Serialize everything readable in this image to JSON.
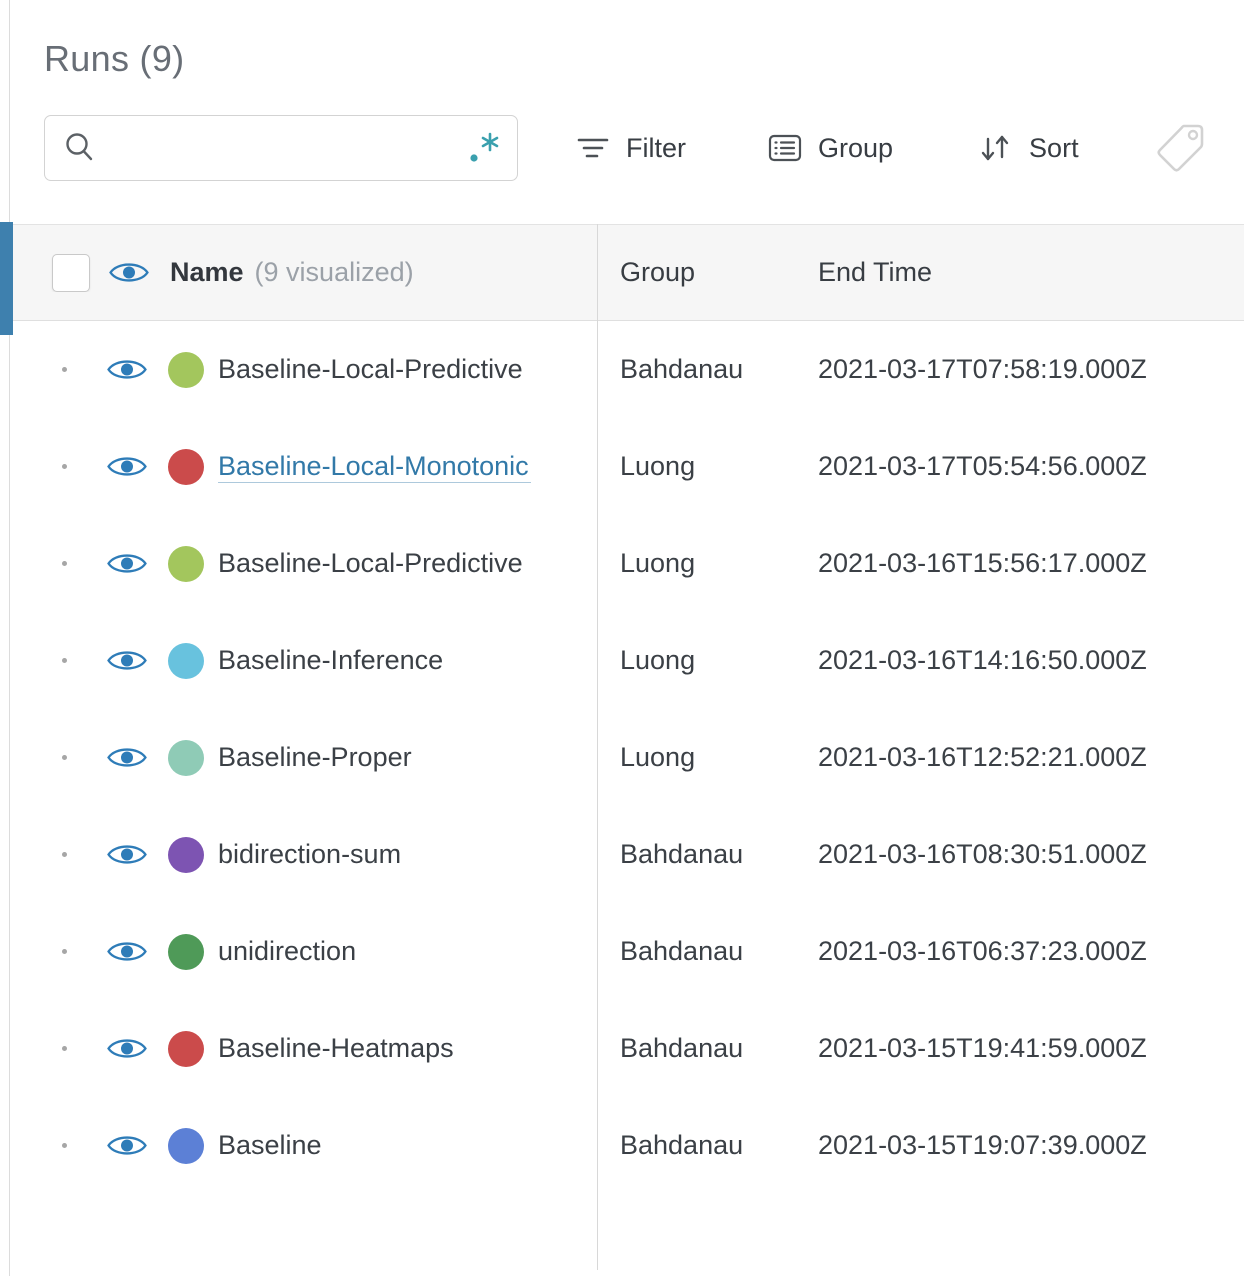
{
  "panel": {
    "title": "Runs (9)"
  },
  "search": {
    "value": "",
    "placeholder": ""
  },
  "toolbar": {
    "filter": "Filter",
    "group": "Group",
    "sort": "Sort"
  },
  "table": {
    "header": {
      "name": "Name",
      "visualized": "(9 visualized)",
      "group": "Group",
      "end_time": "End Time"
    },
    "rows": [
      {
        "name": "Baseline-Local-Predictive",
        "color": "#A3C65D",
        "group": "Bahdanau",
        "end_time": "2021-03-17T07:58:19.000Z",
        "highlighted": false
      },
      {
        "name": "Baseline-Local-Monotonic",
        "color": "#CB4B4B",
        "group": "Luong",
        "end_time": "2021-03-17T05:54:56.000Z",
        "highlighted": true
      },
      {
        "name": "Baseline-Local-Predictive",
        "color": "#A3C65D",
        "group": "Luong",
        "end_time": "2021-03-16T15:56:17.000Z",
        "highlighted": false
      },
      {
        "name": "Baseline-Inference",
        "color": "#68C2DE",
        "group": "Luong",
        "end_time": "2021-03-16T14:16:50.000Z",
        "highlighted": false
      },
      {
        "name": "Baseline-Proper",
        "color": "#8FCBB6",
        "group": "Luong",
        "end_time": "2021-03-16T12:52:21.000Z",
        "highlighted": false
      },
      {
        "name": "bidirection-sum",
        "color": "#7D54B2",
        "group": "Bahdanau",
        "end_time": "2021-03-16T08:30:51.000Z",
        "highlighted": false
      },
      {
        "name": "unidirection",
        "color": "#4F9A58",
        "group": "Bahdanau",
        "end_time": "2021-03-16T06:37:23.000Z",
        "highlighted": false
      },
      {
        "name": "Baseline-Heatmaps",
        "color": "#CB4B4B",
        "group": "Bahdanau",
        "end_time": "2021-03-15T19:41:59.000Z",
        "highlighted": false
      },
      {
        "name": "Baseline",
        "color": "#5C80D6",
        "group": "Bahdanau",
        "end_time": "2021-03-15T19:07:39.000Z",
        "highlighted": false
      }
    ]
  },
  "colors": {
    "accent_bar": "#3E80AE",
    "eye_blue": "#2E7CB8",
    "link_blue": "#3279A8",
    "regex_teal": "#3AA0AE",
    "tag_gray": "#D2D2D2"
  }
}
